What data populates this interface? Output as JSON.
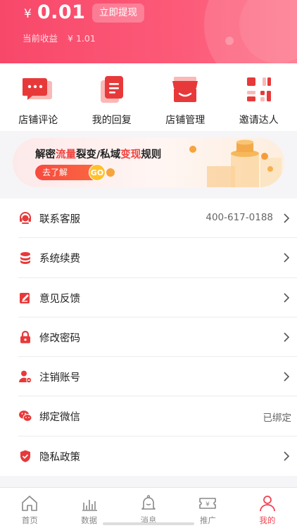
{
  "header": {
    "currency": "¥",
    "balance": "0.01",
    "withdraw_label": "立即提现",
    "earnings_label": "当前收益",
    "earnings_value": "¥  1.01"
  },
  "shortcuts": [
    {
      "label": "店铺评论",
      "icon": "comment-bubble-icon"
    },
    {
      "label": "我的回复",
      "icon": "document-icon"
    },
    {
      "label": "店铺管理",
      "icon": "storefront-icon"
    },
    {
      "label": "邀请达人",
      "icon": "qr-code-icon"
    }
  ],
  "banner": {
    "title_1": "解密",
    "title_hl1": "流量",
    "title_2": "裂变/私域",
    "title_hl2": "变现",
    "title_3": "规则",
    "cta": "去了解",
    "go": "GO"
  },
  "menu": [
    {
      "label": "联系客服",
      "value": "400-617-0188",
      "icon": "headset-icon",
      "chevron": true
    },
    {
      "label": "系统续费",
      "value": "",
      "icon": "coins-icon",
      "chevron": true
    },
    {
      "label": "意见反馈",
      "value": "",
      "icon": "feedback-edit-icon",
      "chevron": true
    },
    {
      "label": "修改密码",
      "value": "",
      "icon": "lock-icon",
      "chevron": true
    },
    {
      "label": "注销账号",
      "value": "",
      "icon": "user-remove-icon",
      "chevron": true
    },
    {
      "label": "绑定微信",
      "value": "已绑定",
      "icon": "wechat-icon",
      "chevron": false
    },
    {
      "label": "隐私政策",
      "value": "",
      "icon": "shield-check-icon",
      "chevron": true
    }
  ],
  "tabs": [
    {
      "label": "首页",
      "icon": "home-icon",
      "active": false
    },
    {
      "label": "数据",
      "icon": "bar-chart-icon",
      "active": false
    },
    {
      "label": "消息",
      "icon": "bell-icon",
      "active": false
    },
    {
      "label": "推广",
      "icon": "ticket-icon",
      "active": false
    },
    {
      "label": "我的",
      "icon": "person-icon",
      "active": true
    }
  ],
  "colors": {
    "brand": "#f8486a",
    "accent": "#f1424f",
    "banner_highlight": "#f0433f"
  }
}
